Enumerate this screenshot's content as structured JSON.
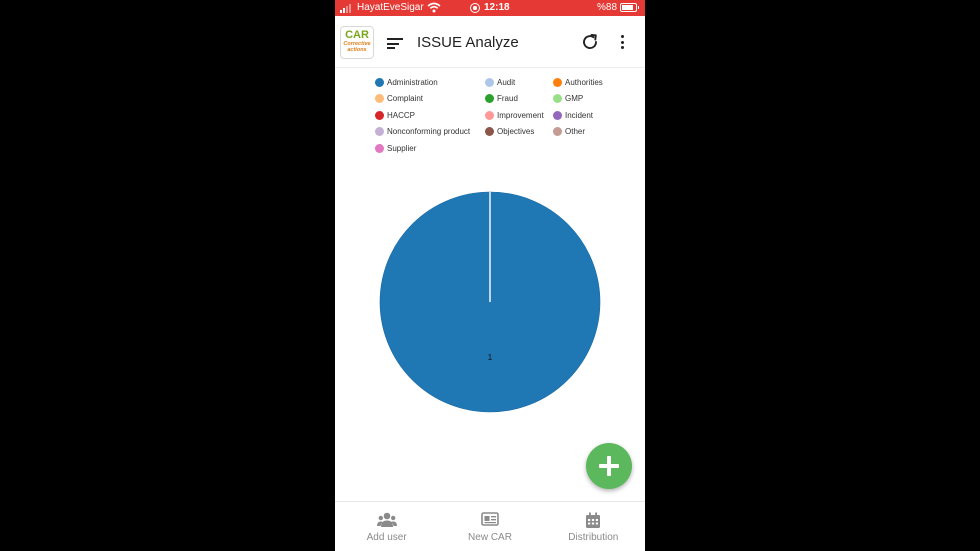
{
  "status_bar": {
    "carrier": "HayatEveSigar",
    "time": "12:18",
    "battery": "%88"
  },
  "app_bar": {
    "logo_line1": "CAR",
    "logo_line2": "Corrective",
    "logo_line3": "actions",
    "title": "ISSUE Analyze",
    "icons": [
      "menu-icon",
      "refresh-icon",
      "more-vert-icon"
    ]
  },
  "legend": [
    {
      "label": "Administration",
      "color": "#1f77b4"
    },
    {
      "label": "Audit",
      "color": "#aec7e8"
    },
    {
      "label": "Authorities",
      "color": "#ff7f0e"
    },
    {
      "label": "Complaint",
      "color": "#ffbb78"
    },
    {
      "label": "Fraud",
      "color": "#2ca02c"
    },
    {
      "label": "GMP",
      "color": "#98df8a"
    },
    {
      "label": "HACCP",
      "color": "#d62728"
    },
    {
      "label": "Improvement",
      "color": "#ff9896"
    },
    {
      "label": "Incident",
      "color": "#9467bd"
    },
    {
      "label": "Nonconforming product",
      "color": "#c5b0d5"
    },
    {
      "label": "Objectives",
      "color": "#8c564b"
    },
    {
      "label": "Other",
      "color": "#c49c94"
    },
    {
      "label": "Supplier",
      "color": "#e377c2"
    }
  ],
  "chart_data": {
    "type": "pie",
    "categories": [
      "Administration",
      "Audit",
      "Authorities",
      "Complaint",
      "Fraud",
      "GMP",
      "HACCP",
      "Improvement",
      "Incident",
      "Nonconforming product",
      "Objectives",
      "Other",
      "Supplier"
    ],
    "values": [
      1,
      0,
      0,
      0,
      0,
      0,
      0,
      0,
      0,
      0,
      0,
      0,
      0
    ],
    "data_labels": [
      "1"
    ],
    "legend_position": "top"
  },
  "fab": {
    "icon": "plus-icon"
  },
  "bottom_nav": [
    {
      "label": "Add user",
      "icon": "users-icon"
    },
    {
      "label": "New CAR",
      "icon": "card-icon"
    },
    {
      "label": "Distribution",
      "icon": "calendar-icon"
    }
  ]
}
